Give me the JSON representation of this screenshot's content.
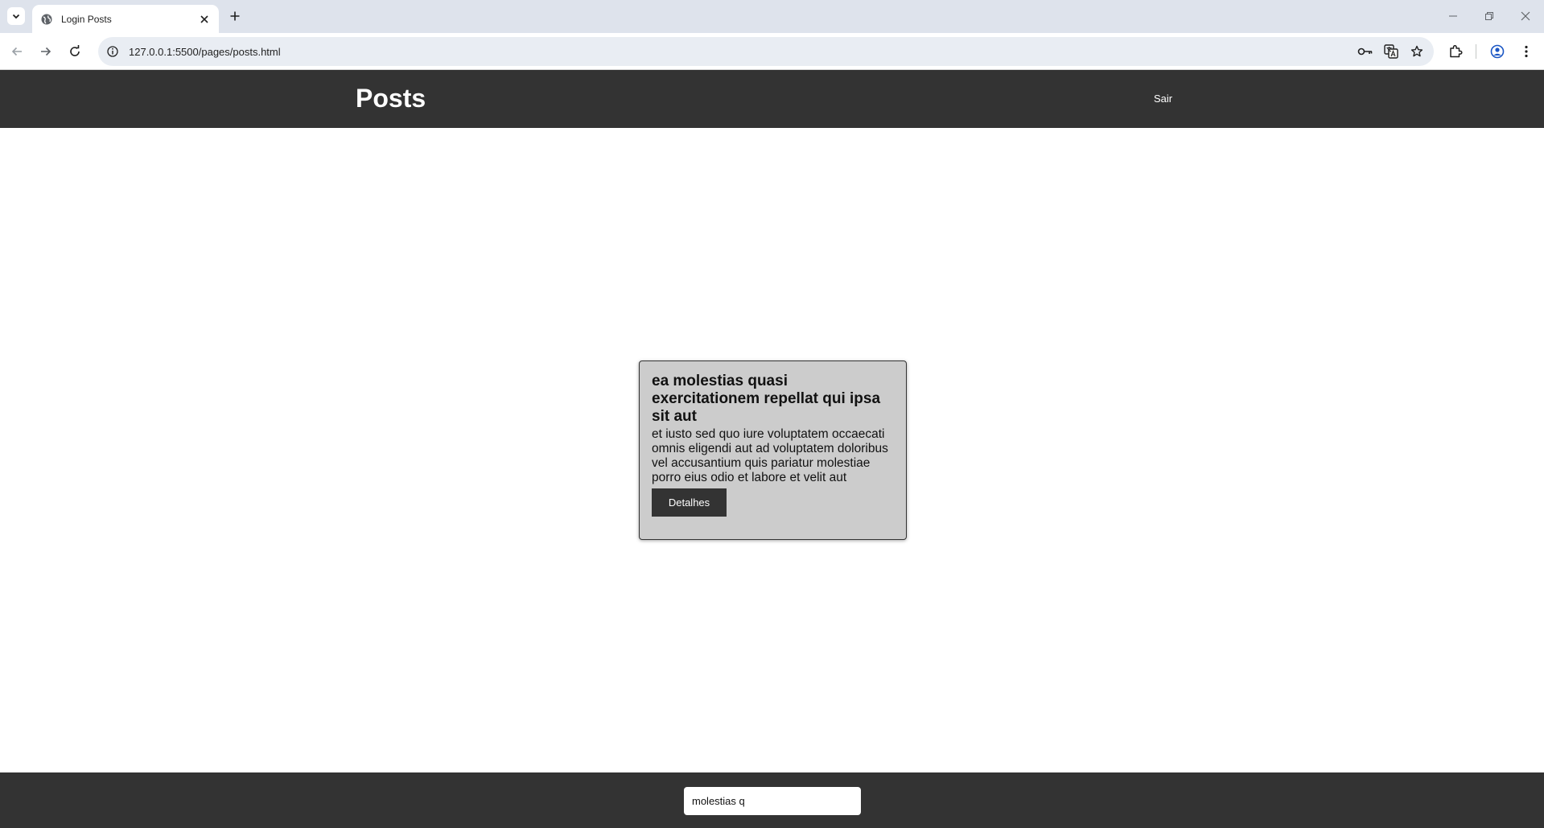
{
  "browser": {
    "tab_title": "Login Posts",
    "url": "127.0.0.1:5500/pages/posts.html"
  },
  "header": {
    "title": "Posts",
    "logout_label": "Sair"
  },
  "post": {
    "title": "ea molestias quasi exercitationem repellat qui ipsa sit aut",
    "body": "et iusto sed quo iure voluptatem occaecati omnis eligendi aut ad voluptatem doloribus vel accusantium quis pariatur molestiae porro eius odio et labore et velit aut",
    "details_label": "Detalhes"
  },
  "footer": {
    "search_value": "molestias q"
  },
  "colors": {
    "header_bg": "#333333",
    "card_bg": "#cccccc",
    "button_bg": "#333333",
    "tabbar_bg": "#dee3ec",
    "omnibox_bg": "#e9edf3"
  }
}
